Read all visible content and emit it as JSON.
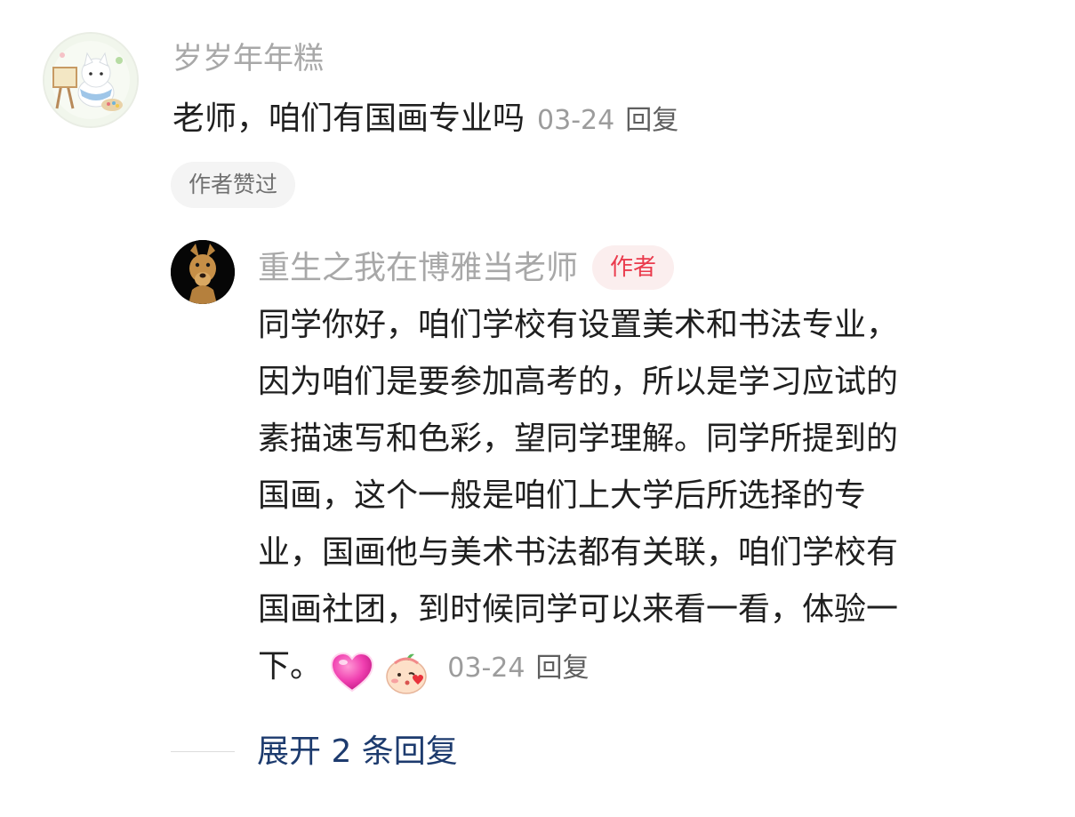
{
  "comment": {
    "username": "岁岁年年糕",
    "text": "老师，咱们有国画专业吗",
    "date": "03-24",
    "reply_label": "回复",
    "liked_badge": "作者赞过"
  },
  "reply": {
    "username": "重生之我在博雅当老师",
    "author_badge": "作者",
    "text_lines": [
      "同学你好，咱们学校有设置美术和书法专业，",
      "因为咱们是要参加高考的，所以是学习应试的",
      "素描速写和色彩，望同学理解。同学所提到的",
      "国画，这个一般是咱们上大学后所选择的专",
      "业，国画他与美术书法都有关联，咱们学校有",
      "国画社团，到时候同学可以来看一看，体验一"
    ],
    "text_tail": "下。",
    "emojis": [
      "pink-heart-emoji",
      "blushing-kiss-emoji"
    ],
    "date": "03-24",
    "reply_label": "回复"
  },
  "expand": {
    "label": "展开 2 条回复"
  },
  "colors": {
    "username": "#a8a8a8",
    "meta_date": "#9c9c9c",
    "author_badge_text": "#ea3b4d",
    "author_badge_bg": "#fbeeee",
    "expand_link": "#1d3b6e"
  }
}
